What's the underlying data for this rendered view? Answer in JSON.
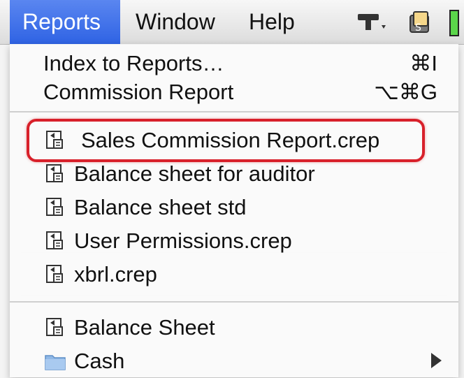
{
  "menubar": {
    "items": [
      {
        "label": "Reports",
        "active": true
      },
      {
        "label": "Window"
      },
      {
        "label": "Help"
      }
    ],
    "status_icons": [
      "display-icon",
      "script-icon",
      "battery-icon"
    ]
  },
  "menu": {
    "top_items": [
      {
        "label": "Index to Reports…",
        "shortcut": "⌘I"
      },
      {
        "label": "Commission Report",
        "shortcut": "⌥⌘G"
      }
    ],
    "report_files": [
      {
        "label": "Sales Commission Report.crep",
        "icon": "report-doc-icon",
        "highlighted": true
      },
      {
        "label": "Balance sheet for auditor",
        "icon": "report-doc-icon"
      },
      {
        "label": "Balance sheet std",
        "icon": "report-doc-icon"
      },
      {
        "label": "User Permissions.crep",
        "icon": "report-doc-icon"
      },
      {
        "label": "xbrl.crep",
        "icon": "report-doc-icon"
      }
    ],
    "bottom_items": [
      {
        "label": "Balance Sheet",
        "icon": "report-doc-icon"
      },
      {
        "label": "Cash",
        "icon": "folder-icon",
        "submenu": true
      }
    ]
  },
  "colors": {
    "menu_highlight": "#3366e6",
    "annotation_ring": "#d8202a"
  }
}
